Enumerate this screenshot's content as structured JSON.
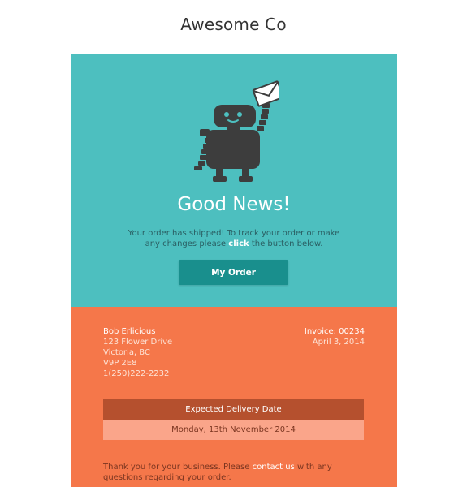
{
  "brand": {
    "name": "Awesome Co"
  },
  "hero": {
    "illustration": "robot-holding-envelope",
    "headline": "Good News!",
    "message_part1": "Your order has shipped! To track your order or make any changes please",
    "message_emphasis": "click",
    "message_part2": "the button below.",
    "button_label": "My Order"
  },
  "customer": {
    "name": "Bob Erlicious",
    "street": "123 Flower Drive",
    "city": "Victoria, BC",
    "postal": "V9P 2E8",
    "phone": "1(250)222-2232"
  },
  "invoice": {
    "label": "Invoice: 00234",
    "date": "April 3, 2014"
  },
  "delivery": {
    "heading": "Expected Delivery Date",
    "date": "Monday, 13th November 2014"
  },
  "footer": {
    "text_before": "Thank you for your business. Please",
    "link_label": "contact us",
    "text_after": "with any questions regarding your order."
  },
  "colors": {
    "hero_bg": "#4dbfbf",
    "button_bg": "#198f8d",
    "details_bg": "#f5774a",
    "delivery_head_bg": "#b5502e",
    "delivery_date_bg": "#faa58a",
    "robot": "#3d3d3d"
  }
}
